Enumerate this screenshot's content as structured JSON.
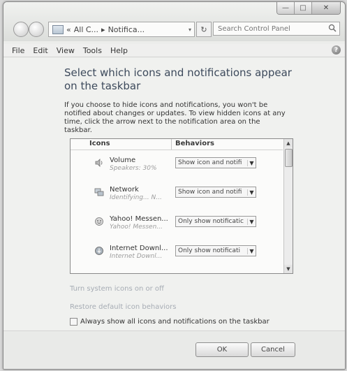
{
  "window": {
    "caption": {
      "minimize": "—",
      "maximize": "□",
      "close": "✕"
    }
  },
  "nav": {
    "address_segments": [
      "«",
      "All C...",
      "▸",
      "Notifica..."
    ],
    "address_dropdown": "▾",
    "refresh": "↻",
    "search_placeholder": "Search Control Panel"
  },
  "menu": {
    "items": [
      "File",
      "Edit",
      "View",
      "Tools",
      "Help"
    ],
    "help_badge": "?"
  },
  "main": {
    "heading": "Select which icons and notifications appear on the taskbar",
    "description": "If you choose to hide icons and notifications, you won't be notified about changes or updates. To view hidden icons at any time, click the arrow next to the notification area on the taskbar.",
    "table": {
      "headers": {
        "icons": "Icons",
        "behaviors": "Behaviors"
      },
      "rows": [
        {
          "icon": "speaker-icon",
          "title": "Volume",
          "subtitle": "Speakers: 30%",
          "behavior": "Show icon and notifi"
        },
        {
          "icon": "network-icon",
          "title": "Network",
          "subtitle": "Identifying... N...",
          "behavior": "Show icon and notifi"
        },
        {
          "icon": "yahoo-messenger-icon",
          "title": "Yahoo! Messen...",
          "subtitle": "Yahoo! Messen...",
          "behavior": "Only show notificatic"
        },
        {
          "icon": "internet-download-icon",
          "title": "Internet Downl...",
          "subtitle": "Internet Downl...",
          "behavior": "Only show notificati"
        }
      ]
    },
    "links": {
      "system_icons": "Turn system icons on or off",
      "restore_defaults": "Restore default icon behaviors"
    },
    "always_show_label": "Always show all icons and notifications on the taskbar"
  },
  "footer": {
    "ok": "OK",
    "cancel": "Cancel"
  },
  "scrollbar": {
    "up": "▲",
    "down": "▼"
  }
}
